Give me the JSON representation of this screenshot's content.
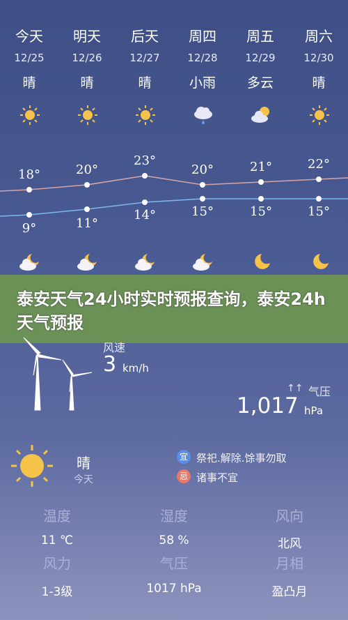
{
  "forecast": [
    {
      "day": "今天",
      "date": "12/25",
      "condition": "晴",
      "high": "18°",
      "low": "9°",
      "icon": "sun-icon",
      "night_icon": "cloud-moon-icon"
    },
    {
      "day": "明天",
      "date": "12/26",
      "condition": "晴",
      "high": "20°",
      "low": "11°",
      "icon": "sun-icon",
      "night_icon": "cloud-moon-icon"
    },
    {
      "day": "后天",
      "date": "12/27",
      "condition": "晴",
      "high": "23°",
      "low": "14°",
      "icon": "sun-icon",
      "night_icon": "cloud-moon-icon"
    },
    {
      "day": "周四",
      "date": "12/28",
      "condition": "小雨",
      "high": "20°",
      "low": "15°",
      "icon": "rain-icon",
      "night_icon": "cloud-moon-icon"
    },
    {
      "day": "周五",
      "date": "12/29",
      "condition": "多云",
      "high": "21°",
      "low": "15°",
      "icon": "cloud-sun-icon",
      "night_icon": "moon-icon"
    },
    {
      "day": "周六",
      "date": "12/30",
      "condition": "晴",
      "high": "22°",
      "low": "15°",
      "icon": "sun-icon",
      "night_icon": "moon-icon"
    }
  ],
  "night_partial": {
    "left": "多云",
    "right": "晴"
  },
  "banner": {
    "title": "泰安天气24小时实时预报查询，泰安24h天气预报"
  },
  "wind": {
    "label": "风速",
    "value": "3",
    "unit": "km/h"
  },
  "pressure": {
    "label": "气压",
    "value": "1,017",
    "unit": "hPa"
  },
  "today": {
    "condition": "晴",
    "sub": "今天"
  },
  "almanac": {
    "yi_badge": "宜",
    "yi_text": "祭祀.解除.馀事勿取",
    "ji_badge": "忌",
    "ji_text": "诸事不宜"
  },
  "details": [
    {
      "label": "温度",
      "value": "11 ℃"
    },
    {
      "label": "湿度",
      "value": "58 %"
    },
    {
      "label": "风向",
      "value": "北风"
    },
    {
      "label": "风力",
      "value": "1-3级"
    },
    {
      "label": "气压",
      "value": "1017 hPa"
    },
    {
      "label": "月相",
      "value": "盈凸月"
    }
  ],
  "colors": {
    "high_line": "#d9a6a6",
    "low_line": "#7fb8f0",
    "sun": "#f6c34a",
    "banner": "#6e9650"
  }
}
